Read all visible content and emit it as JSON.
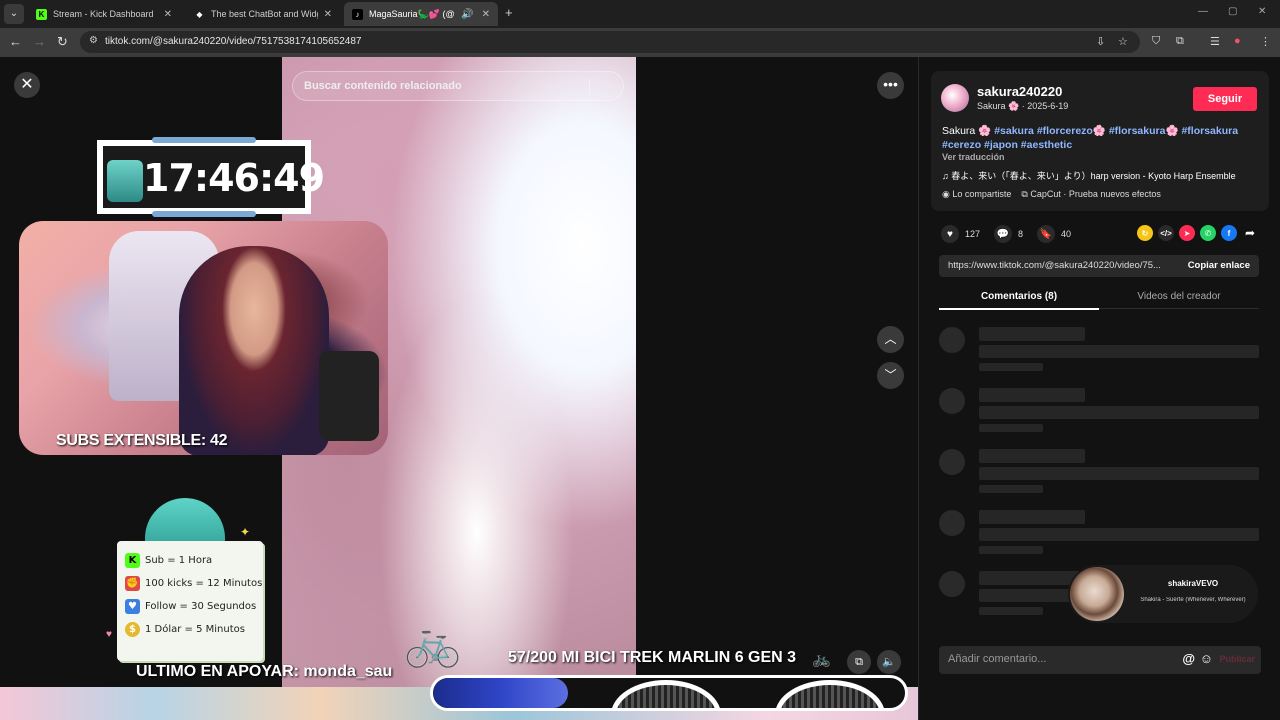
{
  "browser": {
    "tabs": [
      {
        "title": "Stream - Kick Dashboard",
        "icon": "kick-icon"
      },
      {
        "title": "The best ChatBot and Widgets",
        "icon": "streamelements-icon"
      },
      {
        "title": "MagaSauria🦕💕 (@maga",
        "icon": "tiktok-icon",
        "active": true
      }
    ],
    "url": "tiktok.com/@sakura240220/video/7517538174105652487"
  },
  "search": {
    "placeholder": "Buscar contenido relacionado"
  },
  "overlay": {
    "clock": "17:46:49",
    "subs": "SUBS EXTENSIBLE: 42",
    "info": [
      {
        "icon": "K",
        "text": "Sub = 1 Hora",
        "color": "#53fc18"
      },
      {
        "icon": "✊",
        "text": "100 kicks = 12 Minutos",
        "color": "#e04848"
      },
      {
        "icon": "♥",
        "text": "Follow = 30 Segundos",
        "color": "#3b7fe0"
      },
      {
        "icon": "$",
        "text": "1 Dólar = 5 Minutos",
        "color": "#e6b82e"
      }
    ],
    "last_support": "ULTIMO EN APOYAR: monda_sau",
    "goal": "57/200 MI BICI TREK MARLIN 6 GEN 3",
    "goal_progress": 0.285
  },
  "post": {
    "author": "sakura240220",
    "author_sub": "Sakura 🌸 · 2025-6-19",
    "follow": "Seguir",
    "caption_text": "Sakura 🌸 ",
    "tags": [
      "#sakura",
      "#florcerezo🌸",
      "#flor​sakura🌸",
      "#florsakura",
      "#cerezo",
      "#japon",
      "#aesthetic"
    ],
    "see_translation": "Ver traducción",
    "music": "♫  春よ、来い（「春よ、来い」より）harp version - Kyoto Harp Ensemble",
    "shared": "Lo compartiste",
    "capcut": "CapCut · Prueba nuevos efectos",
    "likes": "127",
    "comments": "8",
    "saves": "40",
    "link": "https://www.tiktok.com/@sakura240220/video/75...",
    "copy": "Copiar enlace",
    "tab_comments": "Comentarios (8)",
    "tab_videos": "Videos del creador",
    "comment_placeholder": "Añadir comentario...",
    "publish": "Publicar"
  },
  "pip": {
    "channel": "shakiraVEVO",
    "song": "Shakira - Suerte (Whenever, Wherever)"
  }
}
